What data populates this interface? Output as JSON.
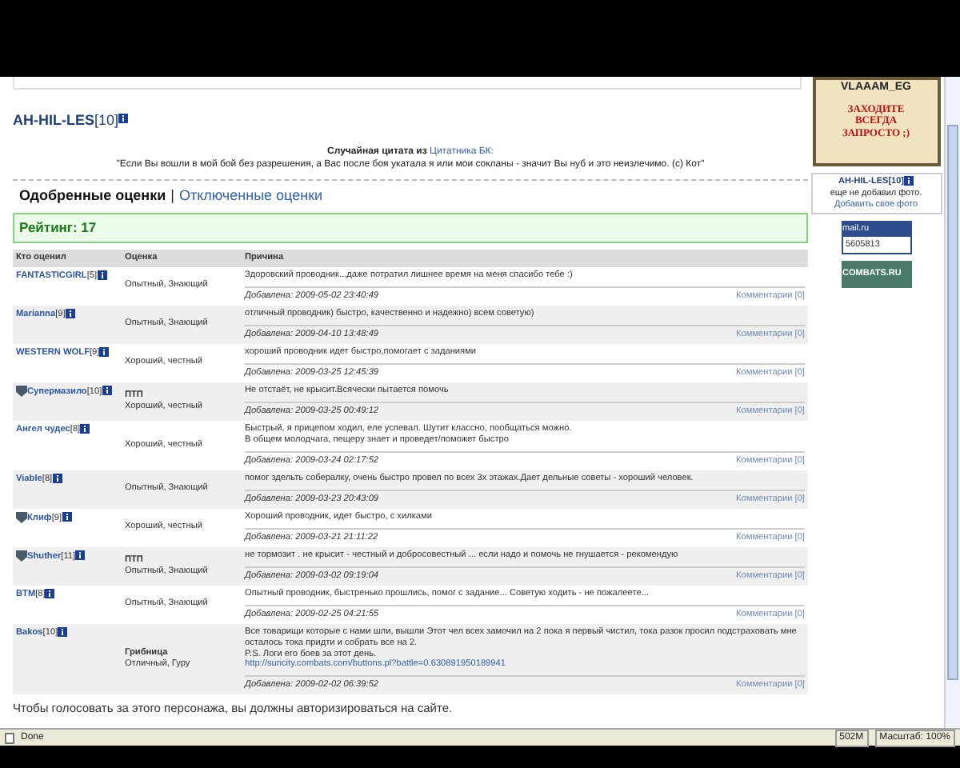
{
  "header": {
    "nick": "AH-HIL-LES",
    "level": "[10]"
  },
  "quote": {
    "intro": "Случайная цитата из",
    "source": "Цитатника БК:",
    "text": "\"Если Вы вошли в мой бой без разрешения, а Вас после боя укатала я или мои сокланы - значит Вы нуб и это неизлечимо. (с) Кот\""
  },
  "tabs": [
    {
      "label": "Одобренные оценки",
      "selected": true
    },
    {
      "label": "Отключенные оценки",
      "selected": false
    }
  ],
  "tab_separator": "|",
  "rating": "Рейтинг: 17",
  "table": {
    "columns": [
      "Кто оценил",
      "Оценка",
      "Причина"
    ],
    "rows": [
      {
        "rater": "FANTASTICGIRL",
        "level": "[5]",
        "clan_icon": false,
        "grade": "Опытный, Знающий",
        "reason": [
          "Здоровский проводник...даже потратил лишнее время на меня спасибо тебе :)"
        ],
        "date": "Добавлена: 2009-05-02 23:40:49",
        "comments": "Комментарии [0]"
      },
      {
        "rater": "Marianna",
        "level": "[9]",
        "clan_icon": false,
        "grade": "Опытный, Знающий",
        "reason": [
          "отличный проводник) быстро, качественно и надежно) всем советую)"
        ],
        "date": "Добавлена: 2009-04-10 13:48:49",
        "comments": "Комментарии [0]"
      },
      {
        "rater": "WESTERN WOLF",
        "level": "[9]",
        "clan_icon": false,
        "grade": "Хороший, честный",
        "reason": [
          "хороший проводник идет быстро,помогает с заданиями"
        ],
        "date": "Добавлена: 2009-03-25 12:45:39",
        "comments": "Комментарии [0]"
      },
      {
        "rater": "Супермазило",
        "level": "[10]",
        "clan_icon": true,
        "title": "ПТП",
        "grade": "Хороший, честный",
        "reason": [
          "Не отстаёт, не крысит.Всячески пытается помочь"
        ],
        "date": "Добавлена: 2009-03-25 00:49:12",
        "comments": "Комментарии [0]"
      },
      {
        "rater": "Ангел чудес",
        "level": "[8]",
        "clan_icon": false,
        "grade": "Хороший, честный",
        "reason": [
          "Быстрый, я прицепом ходил, еле успевал. Шутит классно, пообщаться можно.",
          "В общем молодчага, пещеру знает и проведет/поможет быстро"
        ],
        "date": "Добавлена: 2009-03-24 02:17:52",
        "comments": "Комментарии [0]"
      },
      {
        "rater": "Viable",
        "level": "[8]",
        "clan_icon": false,
        "grade": "Опытный, Знающий",
        "reason": [
          "помог здельть собералку, очень быстро провел по всех 3х этажах.Дает дельные советы - хороший человек."
        ],
        "date": "Добавлена: 2009-03-23 20:43:09",
        "comments": "Комментарии [0]"
      },
      {
        "rater": "Клиф",
        "level": "[9]",
        "clan_icon": true,
        "grade": "Хороший, честный",
        "reason": [
          "Хороший проводник, идет быстро, с хилками"
        ],
        "date": "Добавлена: 2009-03-21 21:11:22",
        "comments": "Комментарии [0]"
      },
      {
        "rater": "Shuther",
        "level": "[11]",
        "clan_icon": true,
        "title": "ПТП",
        "grade": "Опытный, Знающий",
        "reason": [
          "не тормозит . не крысит - честный и добросовестный ... если надо и помочь не гнушается - рекомендую"
        ],
        "date": "Добавлена: 2009-03-02 09:19:04",
        "comments": "Комментарии [0]"
      },
      {
        "rater": "BTM",
        "level": "[8]",
        "clan_icon": false,
        "grade": "Опытный, Знающий",
        "reason": [
          "Опытный проводник, быстренько прошлись, помог с задание... Советую ходить - не пожалеете..."
        ],
        "date": "Добавлена: 2009-02-25 04:21:55",
        "comments": "Комментарии [0]"
      },
      {
        "rater": "Bakos",
        "level": "[10]",
        "clan_icon": false,
        "title": "Грибница",
        "grade": "Отличный, Гуру",
        "reason": [
          "Все товарищи которые с нами шли, вышли Этот чел всех замочил на 2 пока я первый чистил, тока разок просил подстраховать мне осталось тока придти и собрать все на 2.",
          "P.S. Логи его боев за этот день."
        ],
        "link": "http://suncity.combats.com/buttons.pl?battle=0.630891950189941",
        "date": "Добавлена: 2009-02-02 06:39:52",
        "comments": "Комментарии [0]"
      }
    ]
  },
  "footer": "Чтобы голосовать за этого персонажа, вы должны авторизироваться на сайте.",
  "sidebar": {
    "banner": {
      "name": "VLAAAM_EG",
      "lines": [
        "ЗАХОДИТЕ",
        "ВСЕГДА",
        "ЗАПРОСТО ;)"
      ]
    },
    "photo_box": {
      "nick": "AH-HIL-LES",
      "level": "[10]",
      "text": "еще не добавил фото.",
      "link": "Добавить свое фото"
    },
    "counters": [
      {
        "kind": "mail",
        "label": "mail.ru",
        "value": "5605813"
      },
      {
        "kind": "combats",
        "label": "COMBATS.RU"
      }
    ]
  },
  "status_bar": {
    "text": "Done",
    "memory": "502M",
    "zoom": "Масштаб: 100%"
  }
}
